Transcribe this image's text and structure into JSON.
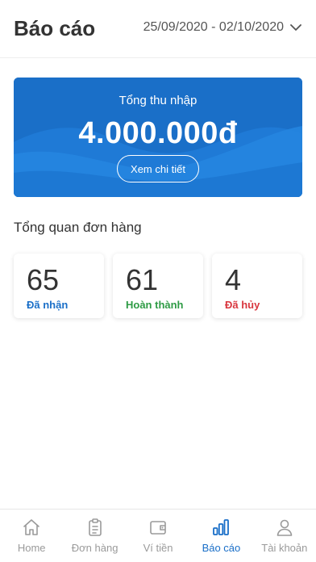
{
  "header": {
    "title": "Báo cáo",
    "date_range": "25/09/2020 - 02/10/2020"
  },
  "income": {
    "label": "Tổng thu nhập",
    "value": "4.000.000đ",
    "detail_button": "Xem chi tiết"
  },
  "overview": {
    "title": "Tổng quan đơn hàng",
    "stats": [
      {
        "value": "65",
        "label": "Đã nhận",
        "color": "#1a6fc8"
      },
      {
        "value": "61",
        "label": "Hoàn thành",
        "color": "#2e9b45"
      },
      {
        "value": "4",
        "label": "Đã hủy",
        "color": "#d9363e"
      }
    ]
  },
  "tab_bar": {
    "items": [
      {
        "label": "Home",
        "icon": "home-icon",
        "active": false
      },
      {
        "label": "Đơn hàng",
        "icon": "clipboard-icon",
        "active": false
      },
      {
        "label": "Ví tiền",
        "icon": "wallet-icon",
        "active": false
      },
      {
        "label": "Báo cáo",
        "icon": "bar-chart-icon",
        "active": true
      },
      {
        "label": "Tài khoản",
        "icon": "user-icon",
        "active": false
      }
    ]
  },
  "colors": {
    "accent": "#1a6fc8",
    "inactive": "#9a9a9a"
  }
}
